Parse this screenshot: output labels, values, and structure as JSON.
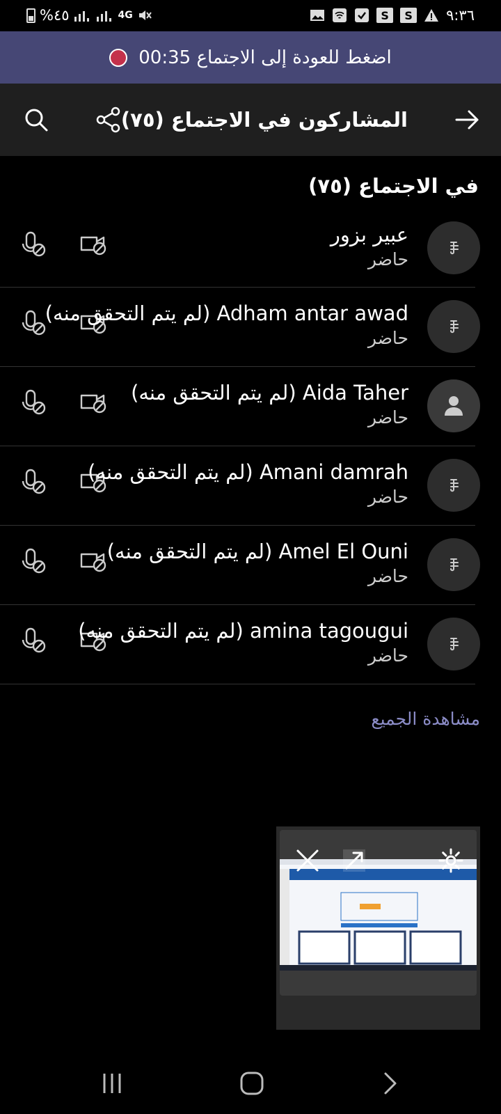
{
  "status_bar": {
    "battery_text": "%٤٥",
    "network": "4G",
    "time": "٩:٣٦",
    "s_badge": "S"
  },
  "banner": {
    "text": "اضغط للعودة إلى الاجتماع 00:35"
  },
  "header": {
    "title": "المشاركون في الاجتماع (٧٥)"
  },
  "section": {
    "title": "في الاجتماع (٧٥)"
  },
  "participants": [
    {
      "name": "عبير بزور",
      "status": "حاضر"
    },
    {
      "name": "Adham antar awad (لم يتم التحقق منه)",
      "status": "حاضر"
    },
    {
      "name": "Aida Taher (لم يتم التحقق منه)",
      "status": "حاضر"
    },
    {
      "name": "Amani damrah (لم يتم التحقق منه)",
      "status": "حاضر"
    },
    {
      "name": "Amel El Ouni (لم يتم التحقق منه)",
      "status": "حاضر"
    },
    {
      "name": "amina tagougui (لم يتم التحقق منه)",
      "status": "حاضر"
    }
  ],
  "see_all": "مشاهدة الجميع",
  "colors": {
    "banner_bg": "#464775",
    "link": "#8b8cc7",
    "record": "#c4314b"
  }
}
